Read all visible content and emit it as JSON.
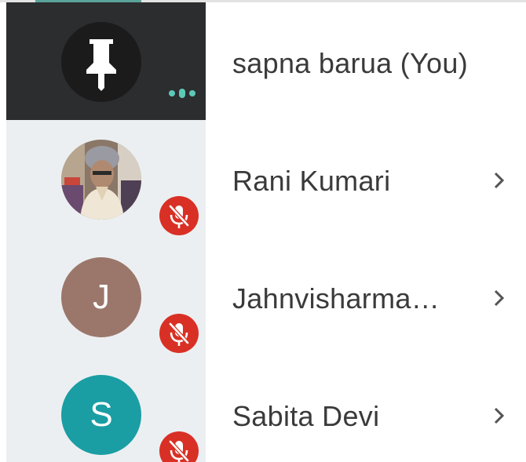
{
  "participants": [
    {
      "name": "sapna barua (You)",
      "is_self": true,
      "avatar_type": "pin",
      "status_icon": "speaking-dots-icon",
      "has_chevron": false
    },
    {
      "name": "Rani Kumari",
      "is_self": false,
      "avatar_type": "photo",
      "status_icon": "mic-off-icon",
      "has_chevron": true
    },
    {
      "name": "Jahnvisharma…",
      "is_self": false,
      "avatar_type": "letter",
      "avatar_letter": "J",
      "avatar_color": "#9b776b",
      "status_icon": "mic-off-icon",
      "has_chevron": true
    },
    {
      "name": "Sabita Devi",
      "is_self": false,
      "avatar_type": "letter",
      "avatar_letter": "S",
      "avatar_color": "#1a9ea4",
      "status_icon": "mic-off-icon",
      "has_chevron": true
    }
  ],
  "colors": {
    "self_tile_bg": "#2b2d2f",
    "tile_column_bg": "#eceff1",
    "mute_badge": "#d93025",
    "speaking_dots": "#5ec8b8",
    "name_text": "#3a3a3a",
    "chevron": "#555555"
  }
}
